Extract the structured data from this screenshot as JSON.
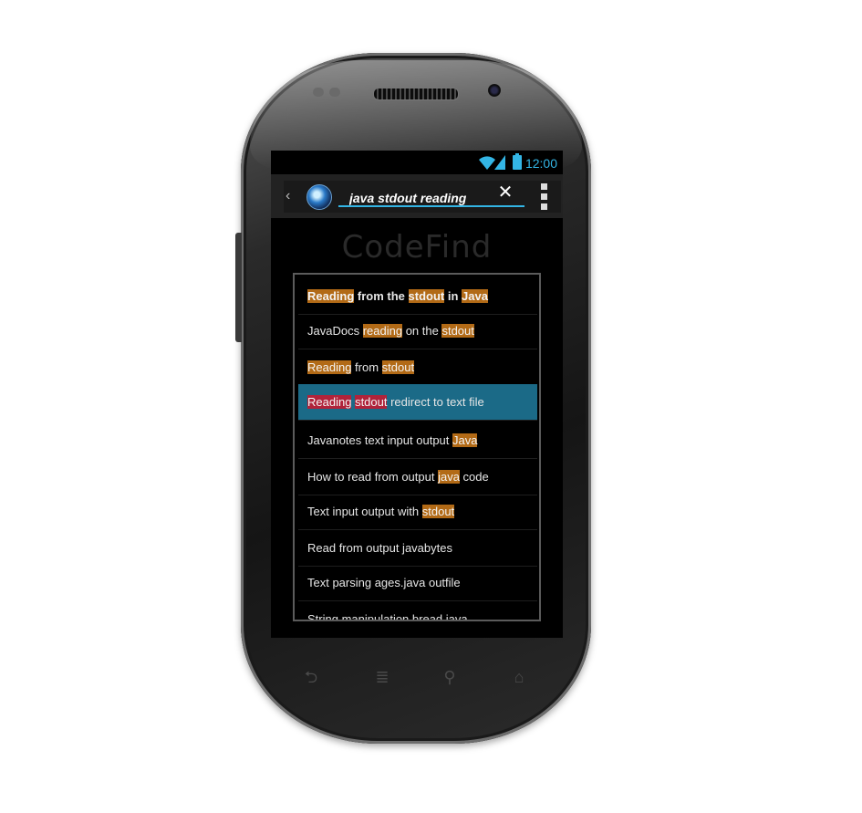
{
  "status_bar": {
    "time": "12:00",
    "wifi_icon": "wifi-icon",
    "signal_icon": "signal-icon",
    "battery_icon": "battery-icon"
  },
  "action_bar": {
    "back_icon": "chevron-left-icon",
    "logo_icon": "globe-logo-icon",
    "search_value": "java stdout reading",
    "clear_icon": "close-icon",
    "menu_icon": "overflow-menu-icon"
  },
  "brand": {
    "title": "CodeFind"
  },
  "results": [
    {
      "parts": [
        {
          "t": "Reading",
          "h": true
        },
        {
          "t": " from the ",
          "h": false
        },
        {
          "t": "stdout",
          "h": true
        },
        {
          "t": " in ",
          "h": false
        },
        {
          "t": "Java",
          "h": true
        }
      ]
    },
    {
      "parts": [
        {
          "t": "JavaDocs ",
          "h": false
        },
        {
          "t": "reading",
          "h": true
        },
        {
          "t": " on the ",
          "h": false
        },
        {
          "t": "stdout",
          "h": true
        }
      ]
    },
    {
      "parts": [
        {
          "t": "Reading",
          "h": true
        },
        {
          "t": " from ",
          "h": false
        },
        {
          "t": "stdout",
          "h": true
        }
      ]
    },
    {
      "parts": [
        {
          "t": "Reading",
          "h": true
        },
        {
          "t": " ",
          "h": false
        },
        {
          "t": "stdout",
          "h": true
        },
        {
          "t": " redirect to text file",
          "h": false
        }
      ],
      "selected": true
    },
    {
      "parts": [
        {
          "t": "Javanotes text input output ",
          "h": false
        },
        {
          "t": "Java",
          "h": true
        }
      ]
    },
    {
      "parts": [
        {
          "t": "How to read from output ",
          "h": false
        },
        {
          "t": "java",
          "h": true
        },
        {
          "t": " code",
          "h": false
        }
      ]
    },
    {
      "parts": [
        {
          "t": "Text input output with ",
          "h": false
        },
        {
          "t": "stdout",
          "h": true
        }
      ]
    },
    {
      "parts": [
        {
          "t": "Read from output javabytes",
          "h": false
        }
      ]
    },
    {
      "parts": [
        {
          "t": "Text parsing ages.java outfile",
          "h": false
        }
      ]
    },
    {
      "parts": [
        {
          "t": "String manipulation bread.java",
          "h": false
        }
      ]
    }
  ],
  "nav_bar": {
    "back": "back-icon",
    "menu": "menu-icon",
    "search": "search-icon",
    "home": "home-icon"
  },
  "colors": {
    "accent": "#33b5e5",
    "highlight": "#b26a16",
    "selected_row": "#1b6a87",
    "selected_highlight": "#b0233a"
  }
}
